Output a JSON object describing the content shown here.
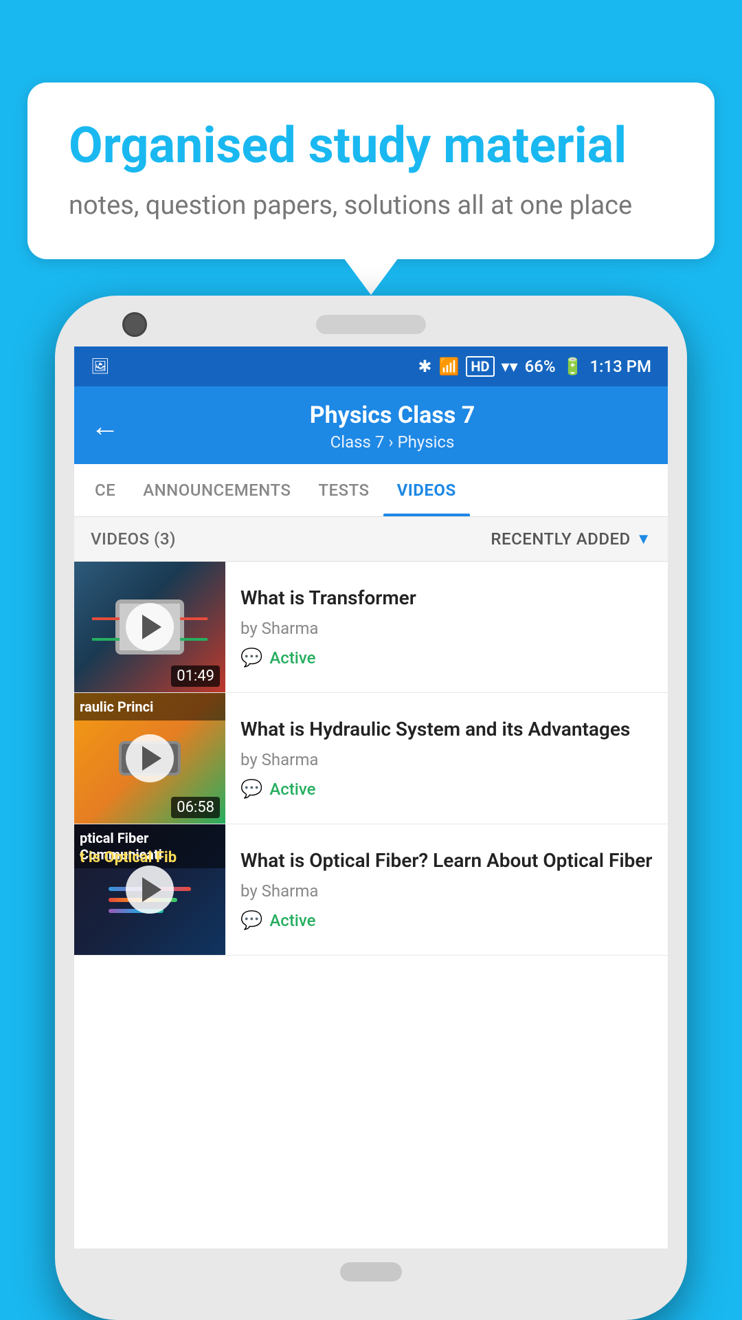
{
  "background_color": "#1ab8f0",
  "speech_bubble": {
    "title": "Organised study material",
    "subtitle": "notes, question papers, solutions all at one place"
  },
  "status_bar": {
    "time": "1:13 PM",
    "battery": "66%",
    "signal": "HD"
  },
  "header": {
    "title": "Physics Class 7",
    "subtitle_part1": "Class 7",
    "subtitle_separator": "  ",
    "subtitle_part2": "Physics",
    "back_label": "←"
  },
  "tabs": [
    {
      "id": "ce",
      "label": "CE",
      "active": false
    },
    {
      "id": "announcements",
      "label": "ANNOUNCEMENTS",
      "active": false
    },
    {
      "id": "tests",
      "label": "TESTS",
      "active": false
    },
    {
      "id": "videos",
      "label": "VIDEOS",
      "active": true
    }
  ],
  "videos_section": {
    "count_label": "VIDEOS (3)",
    "sort_label": "RECENTLY ADDED"
  },
  "videos": [
    {
      "title": "What is  Transformer",
      "author": "by Sharma",
      "status": "Active",
      "duration": "01:49",
      "thumbnail_type": "transformer"
    },
    {
      "title": "What is Hydraulic System and its Advantages",
      "author": "by Sharma",
      "status": "Active",
      "duration": "06:58",
      "thumbnail_type": "hydraulic",
      "thumbnail_label": "raulic Princi"
    },
    {
      "title": "What is Optical Fiber? Learn About Optical Fiber",
      "author": "by Sharma",
      "status": "Active",
      "duration": "",
      "thumbnail_type": "optical",
      "thumbnail_label1": "ptical Fiber Communicati",
      "thumbnail_label2": "t is Optical Fib"
    }
  ]
}
